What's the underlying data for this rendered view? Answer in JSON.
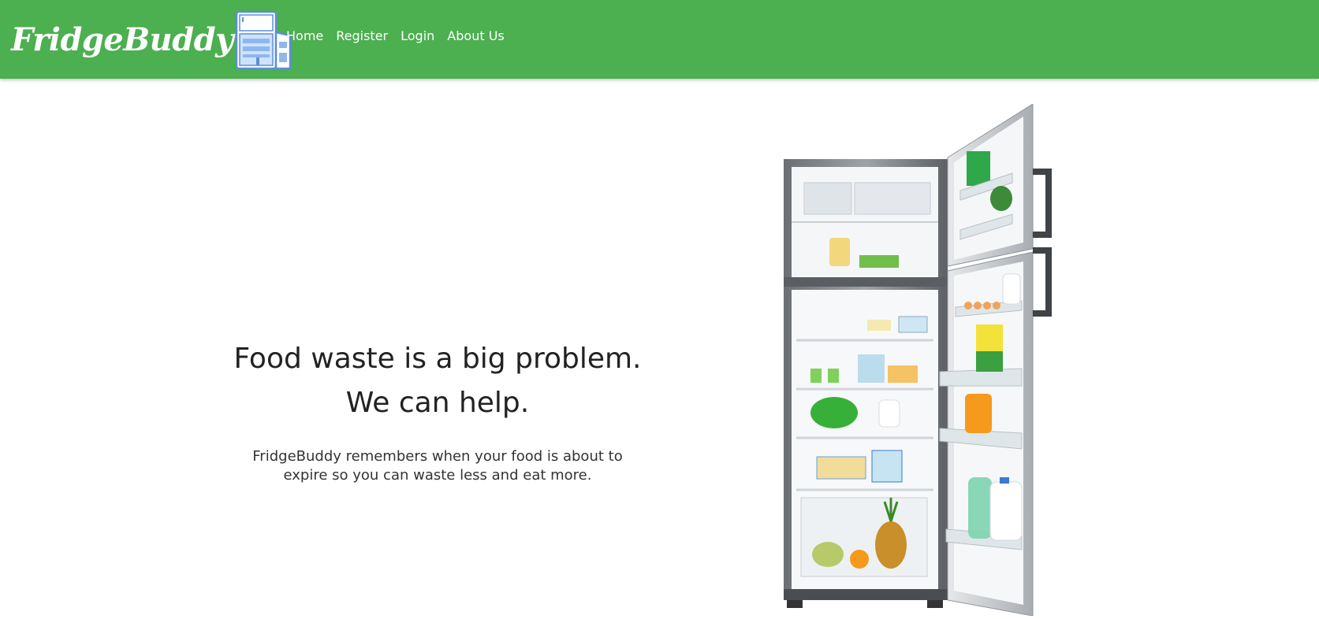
{
  "brand": {
    "name": "FridgeBuddy",
    "color": "#4caf50"
  },
  "nav": {
    "items": [
      {
        "label": "Home"
      },
      {
        "label": "Register"
      },
      {
        "label": "Login"
      },
      {
        "label": "About Us"
      }
    ]
  },
  "hero": {
    "heading_line1": "Food waste is a big problem.",
    "heading_line2": "We can help.",
    "subtext": "FridgeBuddy remembers when your food is about to expire so you can waste less and eat more."
  },
  "icons": {
    "logo": "fridge-logo-icon",
    "hero_image": "open-fridge-illustration"
  }
}
